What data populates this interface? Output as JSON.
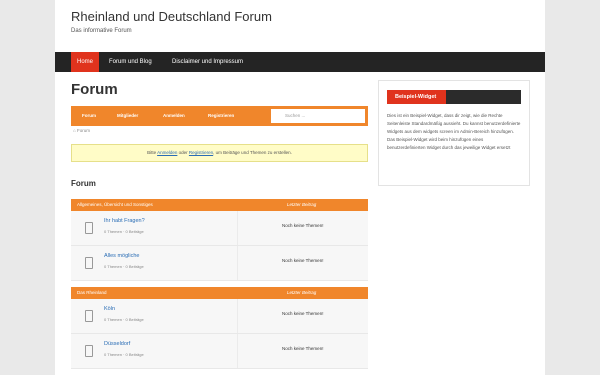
{
  "site": {
    "title": "Rheinland und Deutschland Forum",
    "description": "Das informative Forum"
  },
  "nav": {
    "items": [
      {
        "label": "Home",
        "active": true
      },
      {
        "label": "Forum und Blog",
        "active": false
      },
      {
        "label": "Disclaimer und Impressum",
        "active": false
      }
    ]
  },
  "page": {
    "title": "Forum"
  },
  "forum_nav": {
    "items": [
      "Forum",
      "Mitglieder",
      "Anmelden",
      "Registrieren"
    ],
    "search_placeholder": "Suchen ..."
  },
  "breadcrumb": {
    "label": "Forum"
  },
  "notice": {
    "before": "Bitte ",
    "login": "Anmelden",
    "middle": " oder ",
    "register": "Registrieren",
    "after": ", um Beiträge und Themen zu erstellen."
  },
  "forum_heading": "Forum",
  "categories": [
    {
      "name": "Allgemeines, Übersicht und Sonstiges",
      "last_label": "Letzter Beitrag",
      "forums": [
        {
          "title": "Ihr habt Fragen?",
          "meta": "0 Themen · 0 Beiträge",
          "last": "Noch keine Themen!"
        },
        {
          "title": "Alles mögliche",
          "meta": "0 Themen · 0 Beiträge",
          "last": "Noch keine Themen!"
        }
      ]
    },
    {
      "name": "Das Rheinland",
      "last_label": "Letzter Beitrag",
      "forums": [
        {
          "title": "Köln",
          "meta": "0 Themen · 0 Beiträge",
          "last": "Noch keine Themen!"
        },
        {
          "title": "Düsseldorf",
          "meta": "0 Themen · 0 Beiträge",
          "last": "Noch keine Themen!"
        }
      ]
    }
  ],
  "widget": {
    "title": "Beispiel-Widget",
    "text": "Dies ist ein Beispiel-Widget, dass dir zeigt, wie die Rechte Seitenleiste Standardmäßig aussieht. Du kannst benutzerdefinierte Widgets aus dem widgets screen im Admin-Bereich hinzufügen. Das Beispiel-Widget wird beim hinzufügen eines benutzerdefinierten Widget durch das jeweilige Widget ersetzt"
  }
}
